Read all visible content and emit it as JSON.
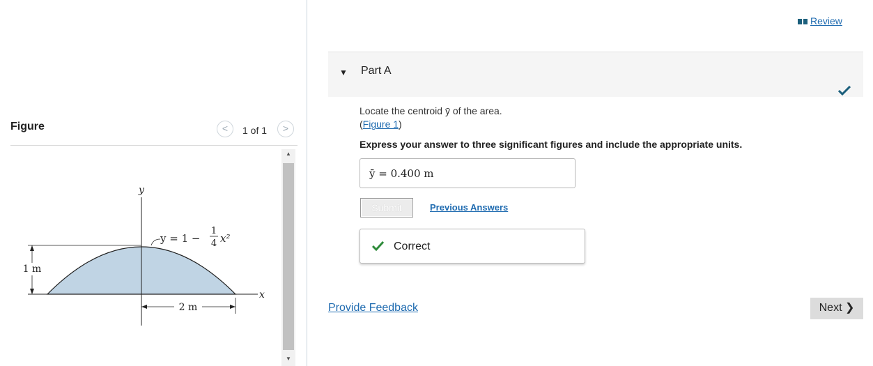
{
  "figure_panel": {
    "title": "Figure",
    "prev_label": "<",
    "next_label": ">",
    "page_count": "1 of 1",
    "diagram": {
      "y_axis_label": "y",
      "x_axis_label": "x",
      "eq_prefix": "y = 1 −",
      "frac_num": "1",
      "frac_den": "4",
      "eq_suffix": "x²",
      "height_label": "1 m",
      "width_label": "2 m",
      "fill_color": "#c0d4e4"
    }
  },
  "header": {
    "review_label": "Review"
  },
  "part": {
    "label": "Part A"
  },
  "question": {
    "text": "Locate the centroid ȳ of the area.",
    "figure_link": "Figure 1",
    "instruction": "Express your answer to three significant figures and include the appropriate units."
  },
  "answer": {
    "value": "ȳ =  0.400 m"
  },
  "actions": {
    "submit_label": "Submit",
    "previous_answers_label": "Previous Answers"
  },
  "feedback": {
    "correct_label": "Correct"
  },
  "footer": {
    "provide_feedback_label": "Provide Feedback",
    "next_label": "Next ❯"
  },
  "colors": {
    "link": "#1f6bb0",
    "correct_green": "#2e8b3a",
    "check_teal": "#1b5f7c"
  }
}
